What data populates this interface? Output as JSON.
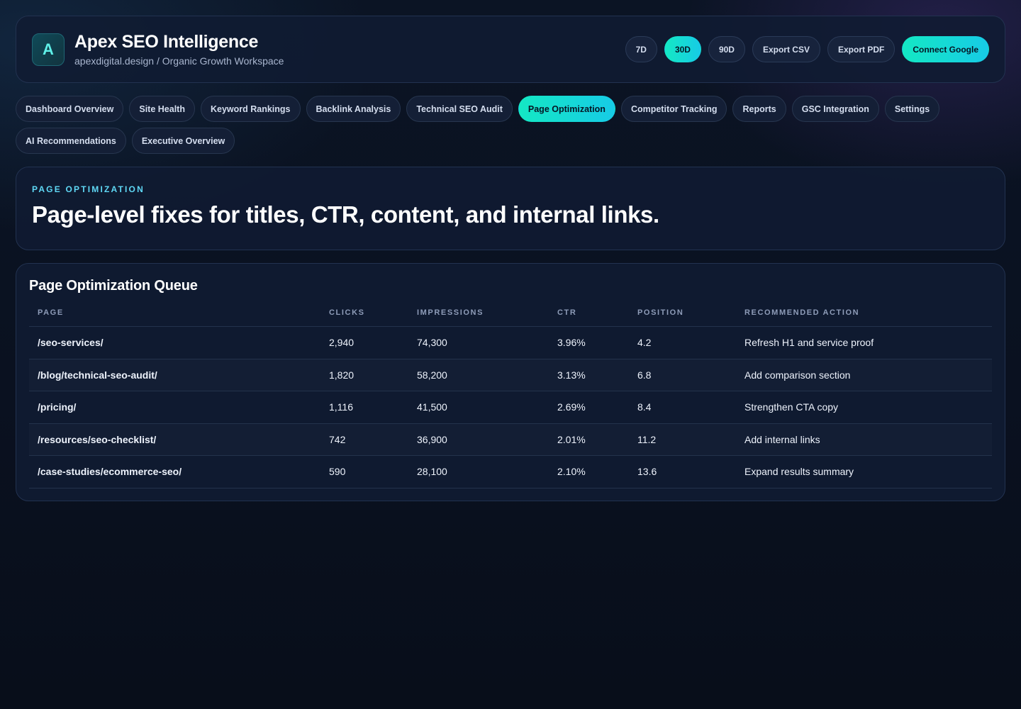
{
  "header": {
    "logo_letter": "A",
    "title": "Apex SEO Intelligence",
    "subtitle": "apexdigital.design / Organic Growth Workspace",
    "range_buttons": [
      {
        "label": "7D",
        "active": false
      },
      {
        "label": "30D",
        "active": true
      },
      {
        "label": "90D",
        "active": false
      }
    ],
    "export_csv": "Export CSV",
    "export_pdf": "Export PDF",
    "connect_google": "Connect Google"
  },
  "nav": {
    "tabs": [
      {
        "label": "Dashboard Overview",
        "active": false
      },
      {
        "label": "Site Health",
        "active": false
      },
      {
        "label": "Keyword Rankings",
        "active": false
      },
      {
        "label": "Backlink Analysis",
        "active": false
      },
      {
        "label": "Technical SEO Audit",
        "active": false
      },
      {
        "label": "Page Optimization",
        "active": true
      },
      {
        "label": "Competitor Tracking",
        "active": false
      },
      {
        "label": "Reports",
        "active": false
      },
      {
        "label": "GSC Integration",
        "active": false
      },
      {
        "label": "Settings",
        "active": false
      },
      {
        "label": "AI Recommendations",
        "active": false
      },
      {
        "label": "Executive Overview",
        "active": false
      }
    ]
  },
  "hero": {
    "eyebrow": "PAGE OPTIMIZATION",
    "title": "Page-level fixes for titles, CTR, content, and internal links."
  },
  "queue": {
    "title": "Page Optimization Queue",
    "columns": [
      "PAGE",
      "CLICKS",
      "IMPRESSIONS",
      "CTR",
      "POSITION",
      "RECOMMENDED ACTION"
    ],
    "rows": [
      {
        "page": "/seo-services/",
        "clicks": "2,940",
        "impressions": "74,300",
        "ctr": "3.96%",
        "position": "4.2",
        "action": "Refresh H1 and service proof"
      },
      {
        "page": "/blog/technical-seo-audit/",
        "clicks": "1,820",
        "impressions": "58,200",
        "ctr": "3.13%",
        "position": "6.8",
        "action": "Add comparison section"
      },
      {
        "page": "/pricing/",
        "clicks": "1,116",
        "impressions": "41,500",
        "ctr": "2.69%",
        "position": "8.4",
        "action": "Strengthen CTA copy"
      },
      {
        "page": "/resources/seo-checklist/",
        "clicks": "742",
        "impressions": "36,900",
        "ctr": "2.01%",
        "position": "11.2",
        "action": "Add internal links"
      },
      {
        "page": "/case-studies/ecommerce-seo/",
        "clicks": "590",
        "impressions": "28,100",
        "ctr": "2.10%",
        "position": "13.6",
        "action": "Expand results summary"
      }
    ]
  },
  "colors": {
    "accent_start": "#14e8c4",
    "accent_end": "#17cbe6",
    "eyebrow": "#5fd8f5",
    "background": "#0a1120",
    "panel": "#101b32"
  }
}
